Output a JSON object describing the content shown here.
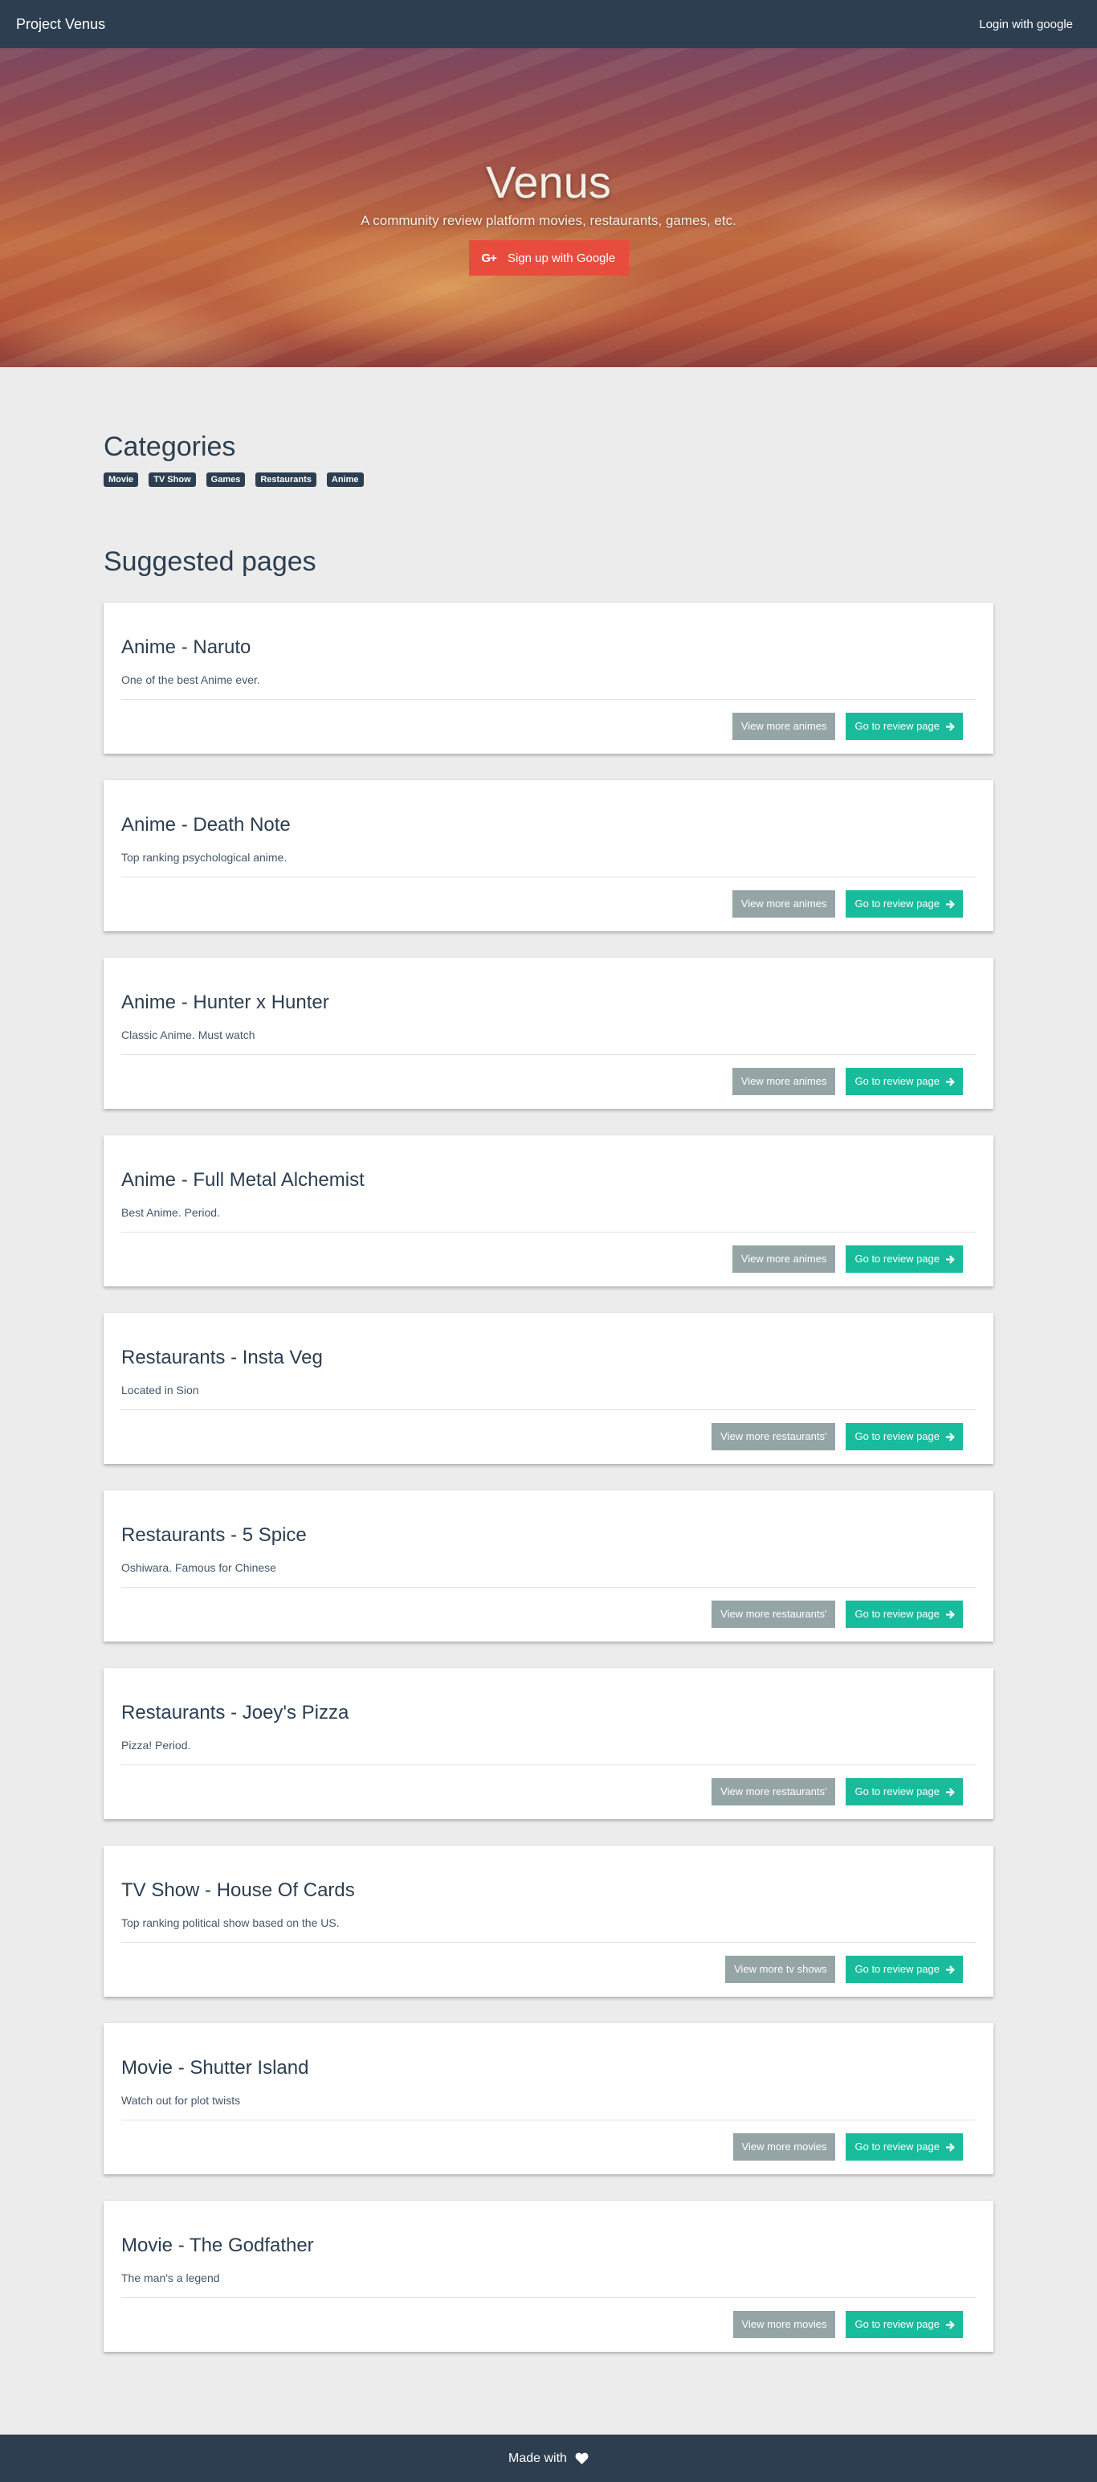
{
  "navbar": {
    "brand": "Project Venus",
    "login_label": "Login with google"
  },
  "hero": {
    "title": "Venus",
    "subtitle": "A community review platform movies, restaurants, games, etc.",
    "signup_icon": "google-plus-icon",
    "signup_icon_text": "G+",
    "signup_label": "Sign up with Google"
  },
  "categories": {
    "title": "Categories",
    "items": [
      "Movie",
      "TV Show",
      "Games",
      "Restaurants",
      "Anime"
    ]
  },
  "suggested": {
    "title": "Suggested pages",
    "review_label": "Go to review page",
    "review_icon": "arrow-right-icon",
    "cards": [
      {
        "title": "Anime - Naruto",
        "description": "One of the best Anime ever.",
        "more_label": "View more animes"
      },
      {
        "title": "Anime - Death Note",
        "description": "Top ranking psychological anime.",
        "more_label": "View more animes"
      },
      {
        "title": "Anime - Hunter x Hunter",
        "description": "Classic Anime. Must watch",
        "more_label": "View more animes"
      },
      {
        "title": "Anime - Full Metal Alchemist",
        "description": "Best Anime. Period.",
        "more_label": "View more animes"
      },
      {
        "title": "Restaurants - Insta Veg",
        "description": "Located in Sion",
        "more_label": "View more restaurants'"
      },
      {
        "title": "Restaurants - 5 Spice",
        "description": "Oshiwara. Famous for Chinese",
        "more_label": "View more restaurants'"
      },
      {
        "title": "Restaurants - Joey's Pizza",
        "description": "Pizza! Period.",
        "more_label": "View more restaurants'"
      },
      {
        "title": "TV Show - House Of Cards",
        "description": "Top ranking political show based on the US.",
        "more_label": "View more tv shows"
      },
      {
        "title": "Movie - Shutter Island",
        "description": "Watch out for plot twists",
        "more_label": "View more movies"
      },
      {
        "title": "Movie - The Godfather",
        "description": "The man's a legend",
        "more_label": "View more movies"
      }
    ]
  },
  "footer": {
    "text": "Made with",
    "icon": "heart-icon"
  },
  "colors": {
    "navbar": "#2c3e50",
    "signup_button": "#e74c3c",
    "review_button": "#18bc9c",
    "more_button": "#95a5a6",
    "background": "#ececec"
  }
}
